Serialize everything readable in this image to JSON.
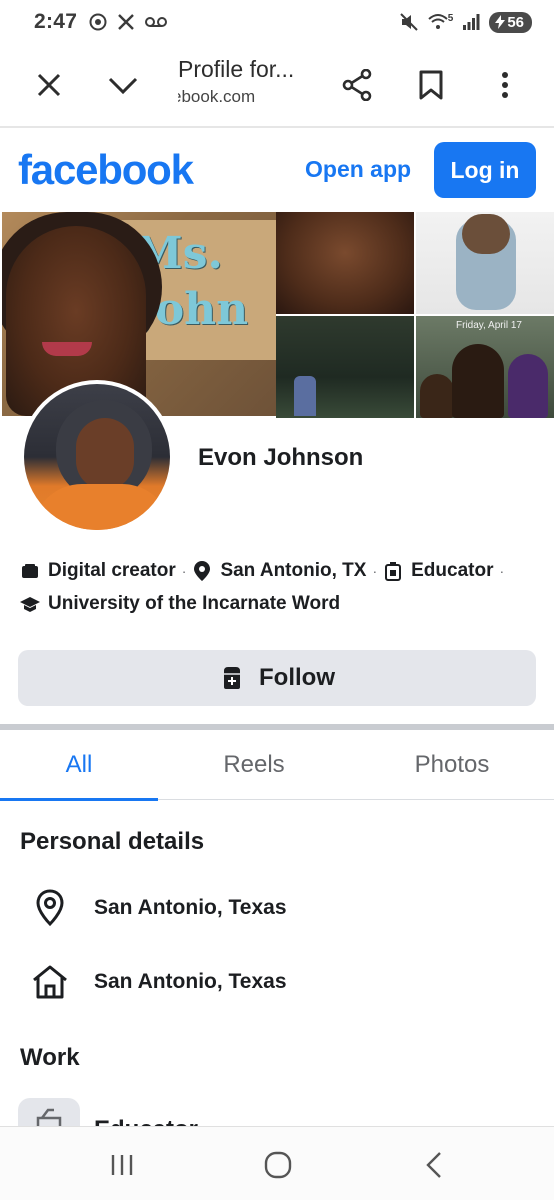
{
  "status_bar": {
    "time": "2:47",
    "battery": "56",
    "wifi_sub": "5"
  },
  "browser": {
    "title": "Profile for...",
    "url": "ebook.com"
  },
  "fb_header": {
    "logo": "facebook",
    "open_app": "Open app",
    "login": "Log in"
  },
  "cover": {
    "sign_text": "Ms. John",
    "tile_date": "Friday, April 17"
  },
  "profile": {
    "name": "Evon Johnson",
    "details": {
      "category": "Digital creator",
      "location": "San Antonio, TX",
      "job": "Educator",
      "school": "University of the Incarnate Word"
    },
    "follow_label": "Follow"
  },
  "tabs": {
    "all": "All",
    "reels": "Reels",
    "photos": "Photos"
  },
  "personal_details": {
    "title": "Personal details",
    "current_city": "San Antonio, Texas",
    "hometown": "San Antonio, Texas"
  },
  "work": {
    "title": "Work",
    "first_item": "Educator"
  },
  "icons": {
    "close": "close-icon",
    "chevron": "chevron-down-icon",
    "share": "share-icon",
    "bookmark": "bookmark-icon",
    "menu": "more-vert-icon",
    "pin": "location-pin-icon",
    "home": "home-icon"
  },
  "colors": {
    "brand": "#1877f2",
    "follow_bg": "#e4e6eb",
    "text": "#1c1e21",
    "muted": "#65676b"
  }
}
